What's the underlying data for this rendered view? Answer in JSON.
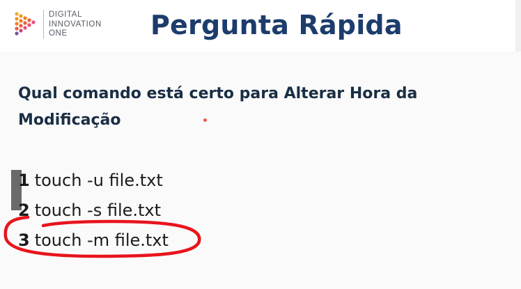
{
  "logo": {
    "lines": [
      "DIGITAL",
      "INNOVATION",
      "ONE"
    ],
    "colors": [
      "#f47b20",
      "#f9a825",
      "#e94e77",
      "#7b4fa0"
    ]
  },
  "slide": {
    "title": "Pergunta Rápida",
    "question": "Qual comando está certo para Alterar Hora da Modificação"
  },
  "options": [
    {
      "number": "1",
      "text": "touch -u file.txt"
    },
    {
      "number": "2",
      "text": "touch -s file.txt"
    },
    {
      "number": "3",
      "text": "touch -m file.txt",
      "highlighted": true
    }
  ],
  "colors": {
    "title": "#1c3c6c",
    "annotation": "#e8141c",
    "accent_dot": "#f05a4a"
  }
}
